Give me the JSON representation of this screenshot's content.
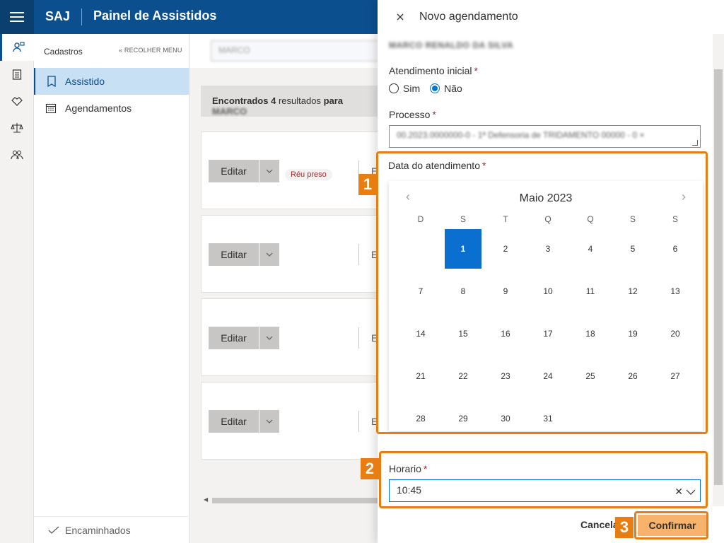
{
  "topbar": {
    "app_name": "SAJ",
    "page_title": "Painel de Assistidos"
  },
  "sidenav": {
    "header": "Cadastros",
    "collapse": "« RECOLHER MENU",
    "items": [
      {
        "label": "Assistido",
        "active": true
      },
      {
        "label": "Agendamentos",
        "active": false
      }
    ],
    "footer": "Encaminhados"
  },
  "main": {
    "search_value": "MARCO",
    "results": {
      "prefix": "Encontrados",
      "count": "4",
      "middle": "resultados",
      "suffix": "para",
      "term": "MARCO"
    },
    "cards": [
      {
        "edit_label": "Editar",
        "badge": "Réu preso",
        "letter": "E"
      },
      {
        "edit_label": "Editar",
        "badge": "",
        "letter": "E"
      },
      {
        "edit_label": "Editar",
        "badge": "",
        "letter": "E"
      },
      {
        "edit_label": "Editar",
        "badge": "",
        "letter": "E"
      }
    ]
  },
  "panel": {
    "title": "Novo agendamento",
    "assisted_name": "MARCO RENALDO DA SILVA",
    "initial": {
      "label": "Atendimento inicial",
      "options": [
        "Sim",
        "Não"
      ],
      "selected": "Não"
    },
    "process": {
      "label": "Processo",
      "value": "00.2023.0000000-0 - 1ª Defensoria de TRIDAMENTO 00000 - 0 ×"
    },
    "date": {
      "label": "Data do atendimento",
      "month": "Maio 2023",
      "weekdays": [
        "D",
        "S",
        "T",
        "Q",
        "Q",
        "S",
        "S"
      ],
      "selected_day": "1",
      "days": [
        "",
        "1",
        "2",
        "3",
        "4",
        "5",
        "6",
        "7",
        "8",
        "9",
        "10",
        "11",
        "12",
        "13",
        "14",
        "15",
        "16",
        "17",
        "18",
        "19",
        "20",
        "21",
        "22",
        "23",
        "24",
        "25",
        "26",
        "27",
        "28",
        "29",
        "30",
        "31"
      ]
    },
    "time": {
      "label": "Horario",
      "value": "10:45"
    },
    "cancel_label": "Cancelar",
    "confirm_label": "Confirmar"
  },
  "annotations": [
    "1",
    "2",
    "3"
  ],
  "colors": {
    "brand": "#0b4f8f",
    "highlight": "#e87d13",
    "selected_day": "#0b6fd0"
  }
}
